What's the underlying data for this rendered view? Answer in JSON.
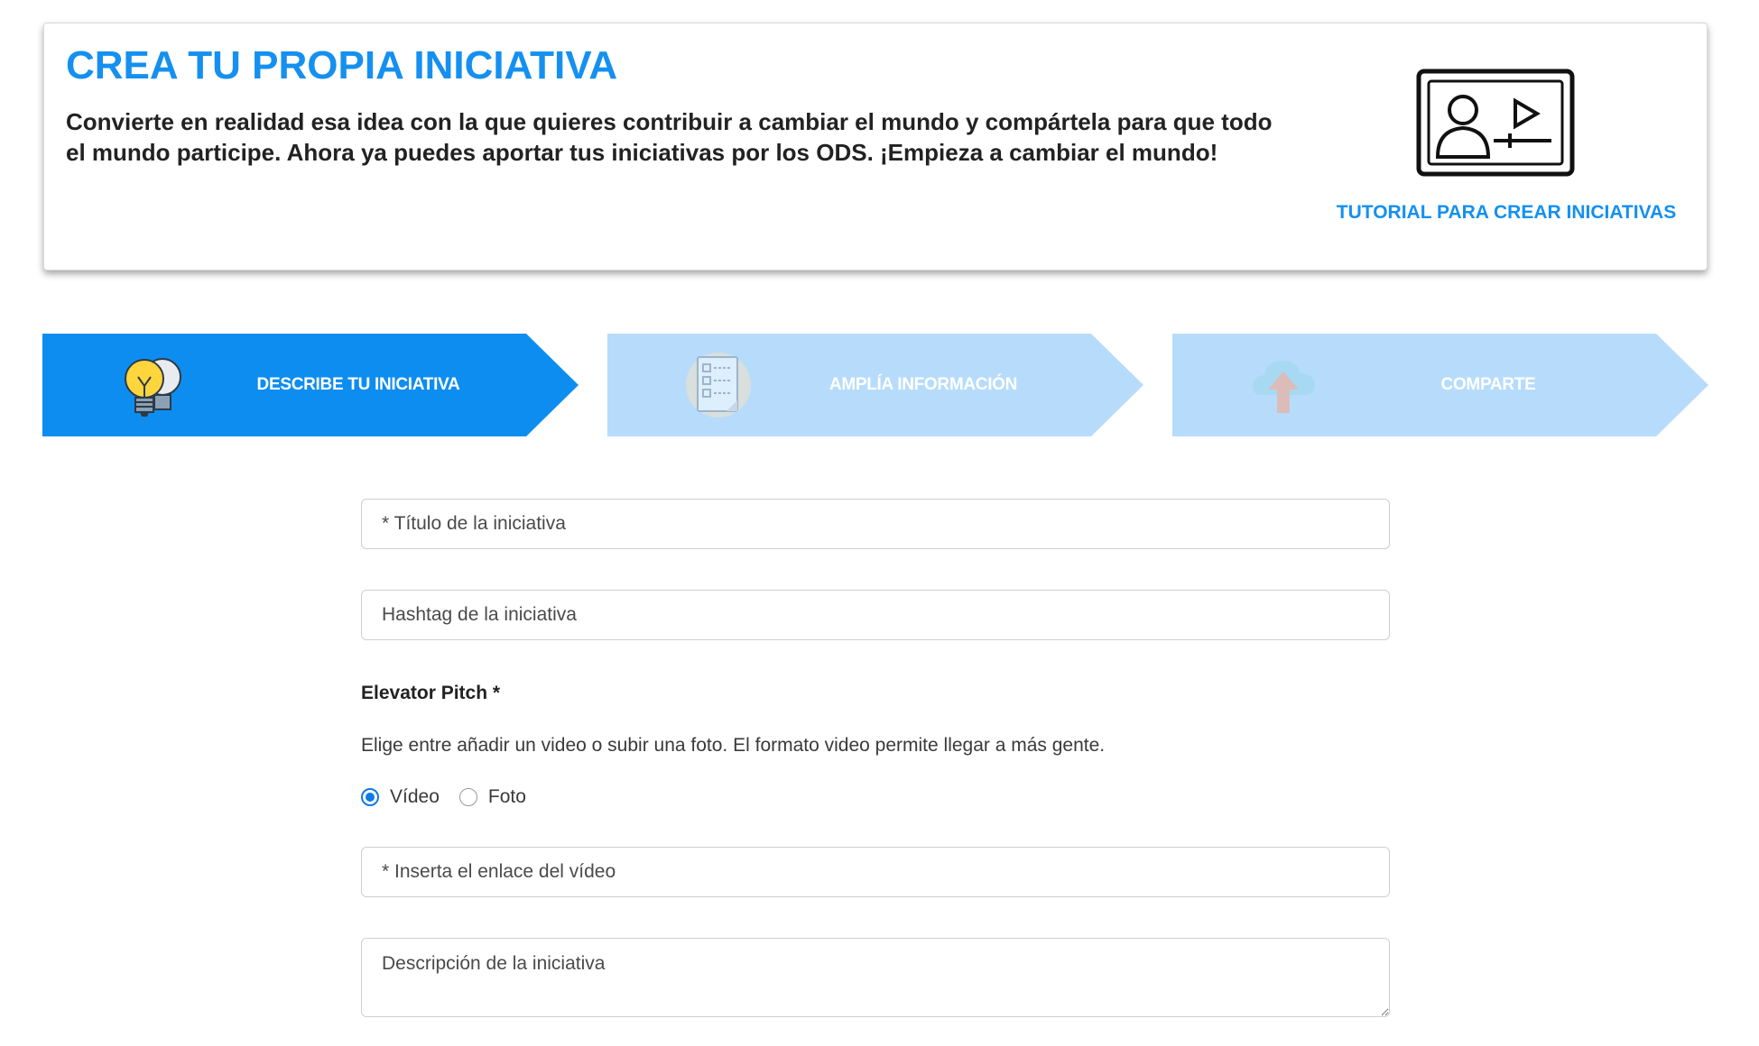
{
  "hero": {
    "title": "CREA TU PROPIA INICIATIVA",
    "description": "Convierte en realidad esa idea con la que quieres contribuir a cambiar el mundo y compártela para que todo el mundo participe. Ahora ya puedes aportar tus iniciativas por los ODS. ¡Empieza a cambiar el mundo!",
    "tutorial_icon": "video-tutorial-icon",
    "tutorial_link": "TUTORIAL PARA CREAR INICIATIVAS"
  },
  "steps": [
    {
      "label": "DESCRIBE TU INICIATIVA",
      "icon": "lightbulbs-icon",
      "state": "active"
    },
    {
      "label": "AMPLÍA INFORMACIÓN",
      "icon": "checklist-icon",
      "state": "inactive"
    },
    {
      "label": "COMPARTE",
      "icon": "cloud-upload-icon",
      "state": "inactive"
    }
  ],
  "form": {
    "title_placeholder": "* Título de la iniciativa",
    "hashtag_placeholder": "Hashtag de la iniciativa",
    "pitch_title": "Elevator Pitch *",
    "pitch_help": "Elige entre añadir un video o subir una foto. El formato video permite llegar a más gente.",
    "options": [
      {
        "label": "Vídeo",
        "checked": true
      },
      {
        "label": "Foto",
        "checked": false
      }
    ],
    "video_placeholder": "* Inserta el enlace del vídeo",
    "description_placeholder": "Descripción de la iniciativa"
  },
  "colors": {
    "accent": "#1590f0",
    "step_active": "#0e8df0",
    "step_inactive": "#b7dcfb",
    "radio_checked": "#0e7ae6"
  }
}
